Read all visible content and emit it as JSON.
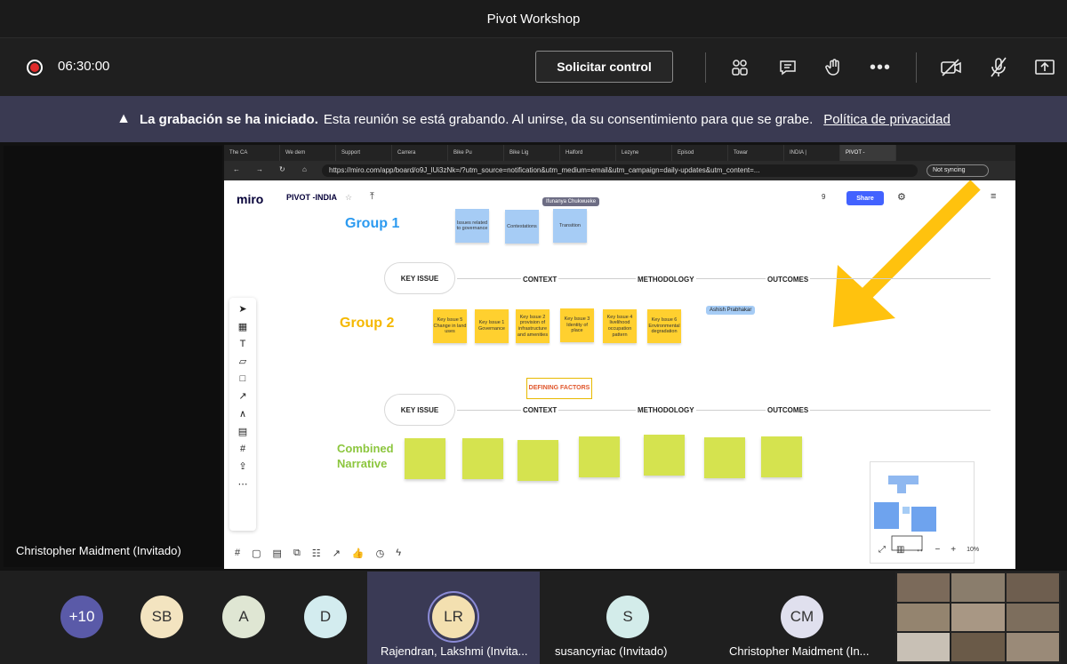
{
  "window": {
    "title": "Pivot Workshop"
  },
  "toolbar": {
    "timer": "06:30:00",
    "request_control": "Solicitar control"
  },
  "banner": {
    "title": "La grabación se ha iniciado.",
    "message": "Esta reunión se está grabando. Al unirse, da su consentimiento para que se grabe.",
    "link": "Política de privacidad"
  },
  "presenter": {
    "name": "Christopher Maidment (Invitado)"
  },
  "browser": {
    "tabs": [
      "The CA",
      "We dem",
      "Support",
      "Carrera",
      "Bike Pu",
      "Bike Lig",
      "Halford",
      "Lezyne",
      "Episod",
      "Towar",
      "INDIA |",
      "PIVOT -"
    ],
    "url": "https://miro.com/app/board/o9J_lUi3zNk=/?utm_source=notification&utm_medium=email&utm_campaign=daily-updates&utm_content=...",
    "sync": "Not syncing"
  },
  "board": {
    "logo": "miro",
    "title": "PIVOT -INDIA",
    "share": "Share",
    "participant_count": "9",
    "zoom": "10%",
    "group1": {
      "label": "Group 1",
      "notes": [
        "Issues related to governance",
        "Contestations",
        "Transition"
      ],
      "cursor": "Ifunanya Chukwueke"
    },
    "row1_headers": {
      "key_issue": "KEY ISSUE",
      "context": "CONTEXT",
      "methodology": "METHODOLOGY",
      "outcomes": "OUTCOMES"
    },
    "group2": {
      "label": "Group 2",
      "notes": [
        "Key Issue 5 Change in land uses",
        "Key Issue 1 Governance",
        "Key Issue 2 provision of infrastructure and amenities",
        "Key Issue 3 Identity of place",
        "Key Issue 4 livelihood occupation pattern",
        "Key Issue 6 Environmental degradation"
      ],
      "cursor": "Ashish Prabhakar"
    },
    "defining_factors": "DEFINING FACTORS",
    "row2_headers": {
      "key_issue": "KEY ISSUE",
      "context": "CONTEXT",
      "methodology": "METHODOLOGY",
      "outcomes": "OUTCOMES"
    },
    "combined": {
      "line1": "Combined",
      "line2": "Narrative"
    }
  },
  "participants": [
    {
      "initials": "+10",
      "color": "#5a5aa8"
    },
    {
      "initials": "SB",
      "color": "#f3e4c0"
    },
    {
      "initials": "A",
      "color": "#dfe6d3"
    },
    {
      "initials": "D",
      "color": "#d3ecef"
    },
    {
      "initials": "LR",
      "color": "#f3e0b0",
      "name": "Rajendran, Lakshmi (Invita..."
    },
    {
      "initials": "S",
      "color": "#d3ecea",
      "name": "susancyriac (Invitado)"
    },
    {
      "initials": "CM",
      "color": "#e0e0ee",
      "name": "Christopher Maidment (In..."
    }
  ],
  "colors": {
    "accent_record": "#e02b2b",
    "banner_bg": "#3a3a52",
    "miro_yellow": "#ffd02f",
    "group_blue": "#2d9bf0",
    "group_orange": "#f5b800",
    "group_green": "#8cc63e"
  }
}
